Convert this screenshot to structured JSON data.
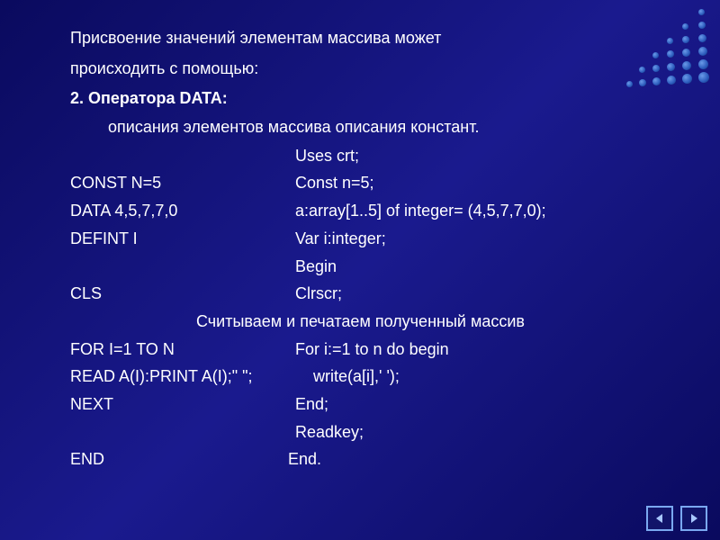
{
  "intro": {
    "line1": "Присвоение значений элементам массива может",
    "line2": "происходить с помощью:"
  },
  "subtitle": "2. Оператора  DATA:",
  "desc": "описания элементов массива   описания констант.",
  "code": {
    "r0_right": "Uses crt;",
    "r1_left": "CONST N=5",
    "r1_right": "Const n=5;",
    "r2_left": "DATA 4,5,7,7,0",
    "r2_right": "a:array[1..5] of integer= (4,5,7,7,0);",
    "r3_left": "DEFINT I",
    "r3_right": "Var i:integer;",
    "r4_right": "Begin",
    "r5_left": "CLS",
    "r5_right": "Clrscr;",
    "note": "Считываем и печатаем полученный массив",
    "r6_left": "FOR I=1 TO N",
    "r6_right": "For i:=1 to n do begin",
    "r7_left": "READ A(I):PRINT A(I);\"  \";",
    "r7_right": "write(a[i],' ');",
    "r8_left": "NEXT",
    "r8_right": "End;",
    "r9_right": "Readkey;",
    "r10_left": "END",
    "r10_right": "End."
  },
  "nav": {
    "prev": "previous",
    "next": "next"
  }
}
